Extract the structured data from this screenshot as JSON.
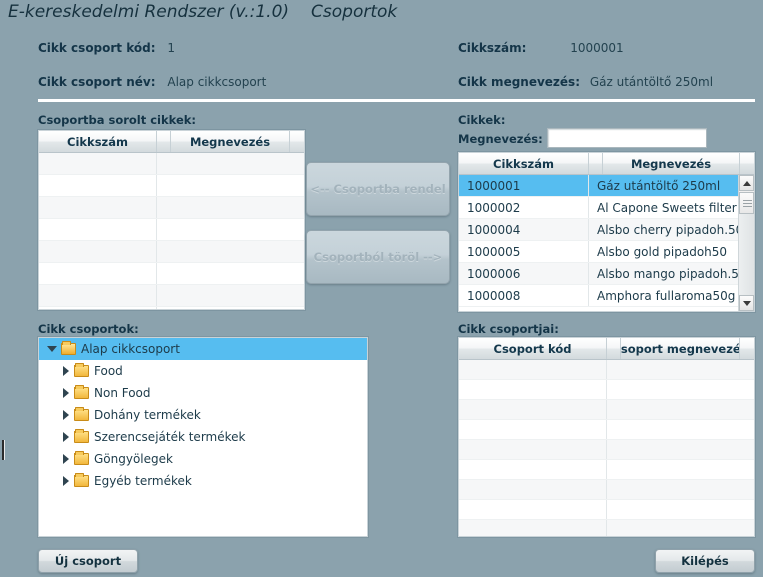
{
  "app": {
    "title": "E-kereskedelmi Rendszer (v.:1.0)",
    "subtitle": "Csoportok",
    "background_color": "#8ba2ad",
    "accent_color": "#56bdf0"
  },
  "header_fields": {
    "group_code_label": "Cikk csoport kód:",
    "group_code_value": "1",
    "group_name_label": "Cikk csoport név:",
    "group_name_value": "Alap cikkcsoport",
    "item_number_label": "Cikkszám:",
    "item_number_value": "1000001",
    "item_name_label": "Cikk megnevezés:",
    "item_name_value": "Gáz utántöltő 250ml"
  },
  "left_panel": {
    "label": "Csoportba sorolt cikkek:",
    "columns": [
      "Cikkszám",
      "Megnevezés"
    ],
    "rows": [],
    "empty_row_count": 8
  },
  "middle_buttons": {
    "assign_label": "<-- Csoportba rendel",
    "remove_label": "Csoportból töröl -->",
    "assign_enabled": false,
    "remove_enabled": false
  },
  "right_panel": {
    "label": "Cikkek:",
    "filter_label": "Megnevezés:",
    "filter_value": "",
    "filter_placeholder": "",
    "columns": [
      "Cikkszám",
      "Megnevezés"
    ],
    "rows": [
      {
        "code": "1000001",
        "name": "Gáz utántöltő 250ml",
        "selected": true
      },
      {
        "code": "1000002",
        "name": "Al Capone Sweets filter",
        "selected": false
      },
      {
        "code": "1000004",
        "name": "Alsbo cherry pipadoh.50",
        "selected": false
      },
      {
        "code": "1000005",
        "name": "Alsbo gold pipadoh50",
        "selected": false
      },
      {
        "code": "1000006",
        "name": "Alsbo mango pipadoh.5",
        "selected": false
      },
      {
        "code": "1000008",
        "name": "Amphora fullaroma50g",
        "selected": false
      }
    ],
    "scrollbar": {
      "up_icon": "triangle-up-icon",
      "down_icon": "triangle-down-icon",
      "thumb_position": "top"
    }
  },
  "tree_panel": {
    "label": "Cikk csoportok:",
    "nodes": [
      {
        "label": "Alap cikkcsoport",
        "level": 0,
        "expanded": true,
        "selected": true,
        "icon": "folder-open-icon"
      },
      {
        "label": "Food",
        "level": 1,
        "expanded": false,
        "selected": false,
        "icon": "folder-icon"
      },
      {
        "label": "Non Food",
        "level": 1,
        "expanded": false,
        "selected": false,
        "icon": "folder-icon"
      },
      {
        "label": "Dohány termékek",
        "level": 1,
        "expanded": false,
        "selected": false,
        "icon": "folder-icon"
      },
      {
        "label": "Szerencsejáték termékek",
        "level": 1,
        "expanded": false,
        "selected": false,
        "icon": "folder-icon"
      },
      {
        "label": "Göngyölegek",
        "level": 1,
        "expanded": false,
        "selected": false,
        "icon": "folder-icon"
      },
      {
        "label": "Egyéb termékek",
        "level": 1,
        "expanded": false,
        "selected": false,
        "icon": "folder-icon"
      }
    ]
  },
  "groups_panel": {
    "label": "Cikk csoportjai:",
    "columns": [
      "Csoport kód",
      "Csoport megnevezés"
    ],
    "rows": [],
    "empty_row_count": 9
  },
  "footer": {
    "new_group_label": "Új csoport",
    "exit_label": "Kilépés"
  }
}
